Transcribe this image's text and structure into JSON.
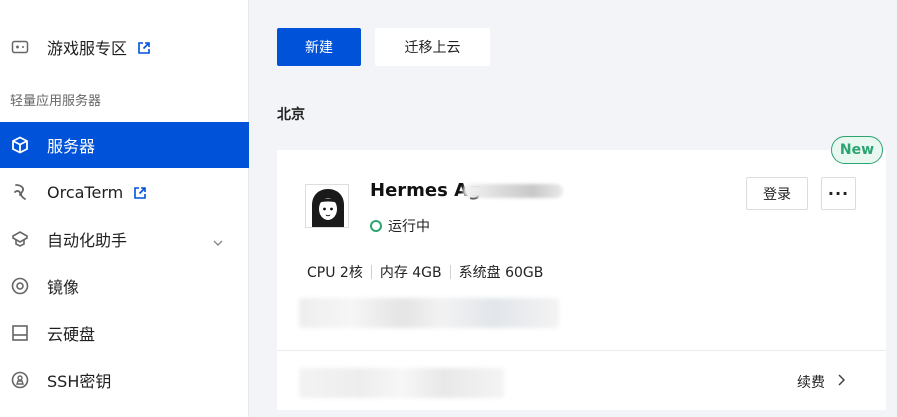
{
  "sidebar": {
    "game_zone_label": "游戏服专区",
    "section_heading": "轻量应用服务器",
    "items": [
      {
        "label": "服务器",
        "icon": "cube-icon",
        "active": true
      },
      {
        "label": "OrcaTerm",
        "icon": "terminal-icon"
      },
      {
        "label": "自动化助手",
        "icon": "automation-icon"
      },
      {
        "label": "镜像",
        "icon": "image-disc-icon"
      },
      {
        "label": "云硬盘",
        "icon": "disk-icon"
      },
      {
        "label": "SSH密钥",
        "icon": "key-icon"
      }
    ]
  },
  "toolbar": {
    "new_label": "新建",
    "migrate_label": "迁移上云"
  },
  "region": "北京",
  "card": {
    "badge": "New",
    "instance_name": "Hermes Ag",
    "status": "运行中",
    "login_label": "登录",
    "more_label": "···",
    "specs": [
      "CPU 2核",
      "内存 4GB",
      "系统盘 60GB"
    ],
    "renew_label": "续费"
  },
  "colors": {
    "primary": "#0052d9",
    "success": "#2ba471"
  }
}
